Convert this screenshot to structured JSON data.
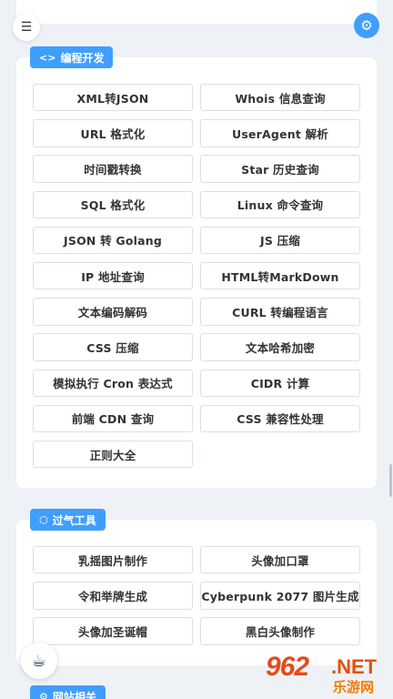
{
  "header": {
    "menu_icon": "list-icon",
    "settings_icon": "gear-icon"
  },
  "sections": [
    {
      "title": "编程开发",
      "icon": "code-icon",
      "tools": [
        "XML转JSON",
        "Whois 信息查询",
        "URL 格式化",
        "UserAgent 解析",
        "时间戳转换",
        "Star 历史查询",
        "SQL 格式化",
        "Linux 命令查询",
        "JSON 转 Golang",
        "JS 压缩",
        "IP 地址查询",
        "HTML转MarkDown",
        "文本编码解码",
        "CURL 转编程语言",
        "CSS 压缩",
        "文本哈希加密",
        "模拟执行 Cron 表达式",
        "CIDR 计算",
        "前端 CDN 查询",
        "CSS 兼容性处理",
        "正则大全"
      ]
    },
    {
      "title": "过气工具",
      "icon": "cube-icon",
      "tools": [
        "乳摇图片制作",
        "头像加口罩",
        "令和举牌生成",
        "Cyberpunk 2077 图片生成",
        "头像加圣诞帽",
        "黑白头像制作"
      ]
    },
    {
      "title": "网站相关",
      "icon": "gear-icon",
      "tools": []
    }
  ],
  "floating": {
    "coffee_icon": "coffee-icon"
  },
  "watermark": {
    "main": "962",
    "net": ".NET",
    "sub": "乐游网"
  },
  "colors": {
    "accent": "#409eff",
    "background": "#eef1f6",
    "watermark": "#e64a19"
  }
}
